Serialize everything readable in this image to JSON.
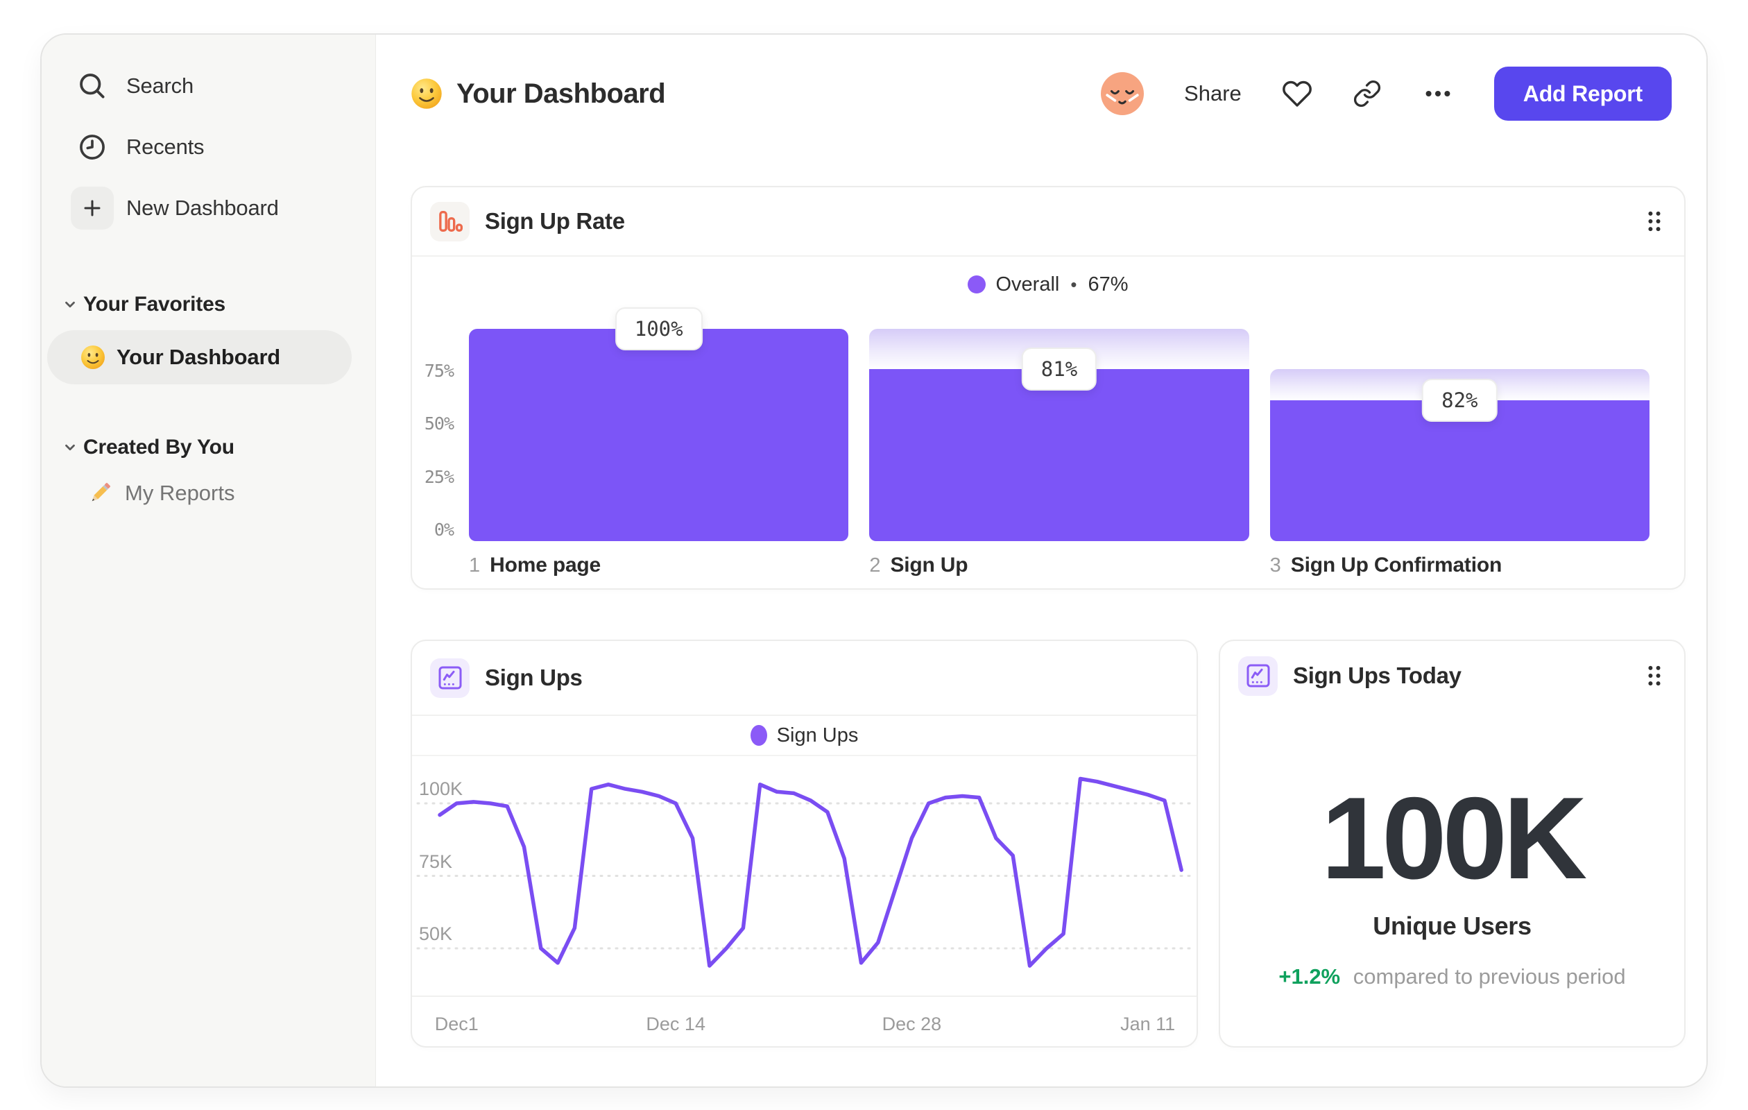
{
  "header": {
    "title": "Your Dashboard",
    "share": "Share",
    "add_report": "Add Report"
  },
  "sidebar": {
    "search": "Search",
    "recents": "Recents",
    "new_dashboard": "New Dashboard",
    "favorites_title": "Your Favorites",
    "favorite_item": "Your Dashboard",
    "created_title": "Created By You",
    "created_item": "My Reports"
  },
  "signup_rate": {
    "title": "Sign Up Rate",
    "legend_label": "Overall",
    "legend_sep": "•",
    "legend_value": "67%"
  },
  "signups": {
    "title": "Sign Ups",
    "legend_label": "Sign Ups"
  },
  "signups_today": {
    "title": "Sign Ups Today",
    "metric": "100K",
    "metric_label": "Unique Users",
    "delta": "+1.2%",
    "delta_note": "compared to previous period"
  },
  "colors": {
    "bar_purple": "#7c55f7",
    "line_purple": "#7a4df2",
    "legend_dot": "#8b5af7",
    "button_indigo": "#5847ee",
    "icon_orange": "#ed6a4c",
    "icon_purple": "#8b5cf6",
    "green": "#0fa15d"
  },
  "chart_data": [
    {
      "type": "funnel-bar",
      "title": "Sign Up Rate",
      "overall_conversion": "67%",
      "y_ticks": [
        "75%",
        "50%",
        "25%",
        "0%"
      ],
      "steps": [
        {
          "index": "1",
          "name": "Home page",
          "conversion_label": "100%",
          "total_pct": 100,
          "solid_pct": 100
        },
        {
          "index": "2",
          "name": "Sign Up",
          "conversion_label": "81%",
          "total_pct": 100,
          "solid_pct": 81
        },
        {
          "index": "3",
          "name": "Sign Up Confirmation",
          "conversion_label": "82%",
          "total_pct": 81,
          "solid_pct": 66.4
        }
      ]
    },
    {
      "type": "line",
      "title": "Sign Ups",
      "unit": "K",
      "ylim": [
        33,
        116
      ],
      "series": [
        {
          "name": "Sign Ups",
          "values": [
            96,
            100,
            100.5,
            100,
            99,
            85,
            50,
            45,
            57,
            105,
            106.5,
            105,
            104,
            102.5,
            100,
            88,
            44,
            50,
            57,
            106.5,
            104,
            103.5,
            101,
            97,
            81,
            45,
            52,
            70,
            88,
            100,
            102,
            102.5,
            102,
            88,
            82,
            44,
            50,
            55,
            108.5,
            107.5,
            106,
            104.5,
            103,
            101,
            77
          ]
        }
      ],
      "y_ticks": [
        {
          "label": "100K",
          "value": 100
        },
        {
          "label": "75K",
          "value": 75
        },
        {
          "label": "50K",
          "value": 50
        }
      ],
      "x_ticks": [
        {
          "label": "Dec1",
          "index": 1
        },
        {
          "label": "Dec 14",
          "index": 14
        },
        {
          "label": "Dec 28",
          "index": 28
        },
        {
          "label": "Jan 11",
          "index": 42
        }
      ],
      "grid": "dotted-horizontal",
      "legend_position": "top-center"
    },
    {
      "type": "metric",
      "title": "Sign Ups Today",
      "value": "100K",
      "label": "Unique Users",
      "delta": "+1.2%",
      "note": "compared to previous period"
    }
  ]
}
